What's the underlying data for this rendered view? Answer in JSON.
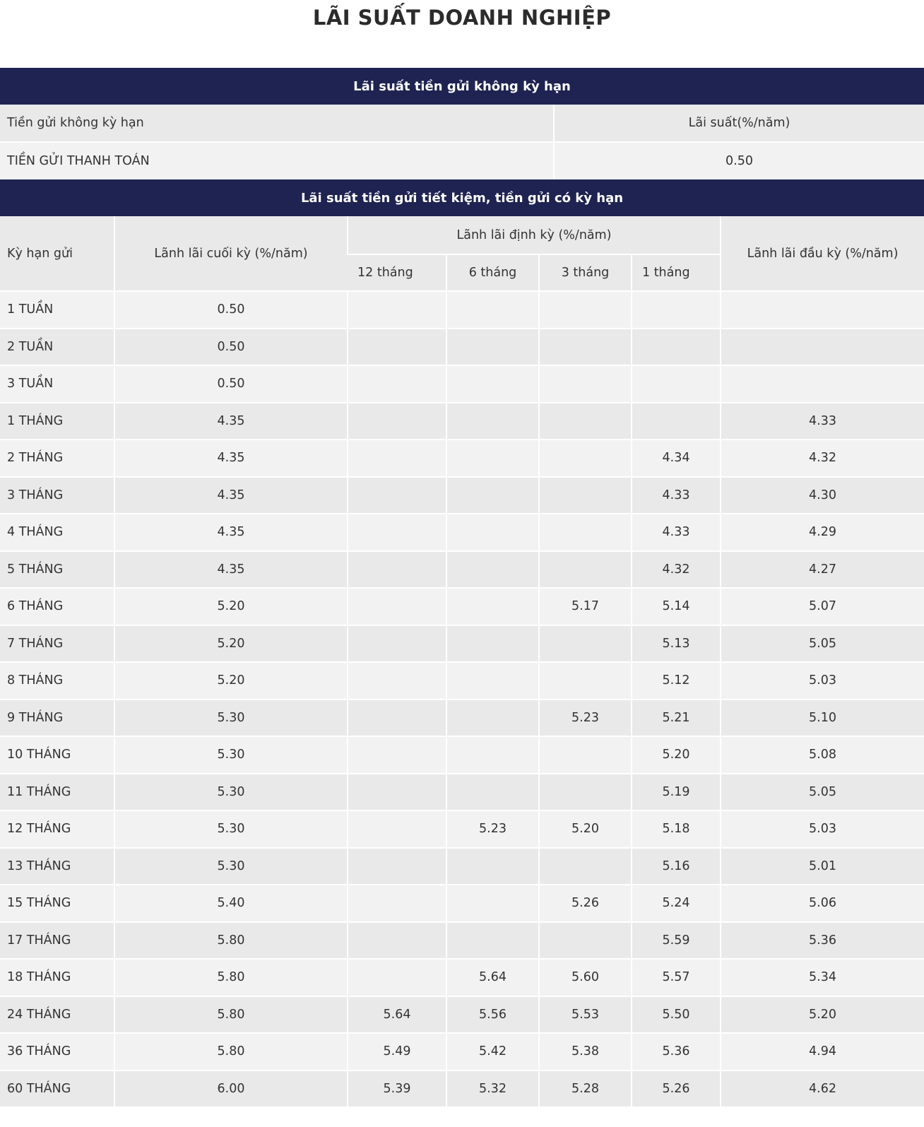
{
  "page": {
    "title": "LÃI SUẤT DOANH NGHIỆP"
  },
  "non_term": {
    "section_title": "Lãi suất tiền gửi không kỳ hạn",
    "headers": [
      "Tiền gửi không kỳ hạn",
      "Lãi suất(%/năm)"
    ],
    "rows": [
      [
        "TIỀN GỬI THANH TOÁN",
        "0.50"
      ]
    ]
  },
  "term": {
    "section_title": "Lãi suất tiền gửi tiết kiệm, tiền gửi có kỳ hạn",
    "header": {
      "term": "Kỳ hạn gửi",
      "end_of_term": "Lãnh lãi cuối kỳ (%/năm)",
      "periodic": "Lãnh lãi định kỳ (%/năm)",
      "periodic_sub": [
        "12 tháng",
        "6 tháng",
        "3 tháng",
        "1 tháng"
      ],
      "start_of_term": "Lãnh lãi đầu kỳ (%/năm)"
    },
    "rows": [
      [
        "1 TUẦN",
        "0.50",
        "",
        "",
        "",
        "",
        ""
      ],
      [
        "2 TUẦN",
        "0.50",
        "",
        "",
        "",
        "",
        ""
      ],
      [
        "3 TUẦN",
        "0.50",
        "",
        "",
        "",
        "",
        ""
      ],
      [
        "1 THÁNG",
        "4.35",
        "",
        "",
        "",
        "",
        "4.33"
      ],
      [
        "2 THÁNG",
        "4.35",
        "",
        "",
        "",
        "4.34",
        "4.32"
      ],
      [
        "3 THÁNG",
        "4.35",
        "",
        "",
        "",
        "4.33",
        "4.30"
      ],
      [
        "4 THÁNG",
        "4.35",
        "",
        "",
        "",
        "4.33",
        "4.29"
      ],
      [
        "5 THÁNG",
        "4.35",
        "",
        "",
        "",
        "4.32",
        "4.27"
      ],
      [
        "6 THÁNG",
        "5.20",
        "",
        "",
        "5.17",
        "5.14",
        "5.07"
      ],
      [
        "7 THÁNG",
        "5.20",
        "",
        "",
        "",
        "5.13",
        "5.05"
      ],
      [
        "8 THÁNG",
        "5.20",
        "",
        "",
        "",
        "5.12",
        "5.03"
      ],
      [
        "9 THÁNG",
        "5.30",
        "",
        "",
        "5.23",
        "5.21",
        "5.10"
      ],
      [
        "10 THÁNG",
        "5.30",
        "",
        "",
        "",
        "5.20",
        "5.08"
      ],
      [
        "11 THÁNG",
        "5.30",
        "",
        "",
        "",
        "5.19",
        "5.05"
      ],
      [
        "12 THÁNG",
        "5.30",
        "",
        "5.23",
        "5.20",
        "5.18",
        "5.03"
      ],
      [
        "13 THÁNG",
        "5.30",
        "",
        "",
        "",
        "5.16",
        "5.01"
      ],
      [
        "15 THÁNG",
        "5.40",
        "",
        "",
        "5.26",
        "5.24",
        "5.06"
      ],
      [
        "17 THÁNG",
        "5.80",
        "",
        "",
        "",
        "5.59",
        "5.36"
      ],
      [
        "18 THÁNG",
        "5.80",
        "",
        "5.64",
        "5.60",
        "5.57",
        "5.34"
      ],
      [
        "24 THÁNG",
        "5.80",
        "5.64",
        "5.56",
        "5.53",
        "5.50",
        "5.20"
      ],
      [
        "36 THÁNG",
        "5.80",
        "5.49",
        "5.42",
        "5.38",
        "5.36",
        "4.94"
      ],
      [
        "60 THÁNG",
        "6.00",
        "5.39",
        "5.32",
        "5.28",
        "5.26",
        "4.62"
      ]
    ]
  },
  "colors": {
    "section_header_bg": "#1e2352",
    "row_light": "#f2f2f2",
    "row_dark": "#e9e9e9"
  }
}
